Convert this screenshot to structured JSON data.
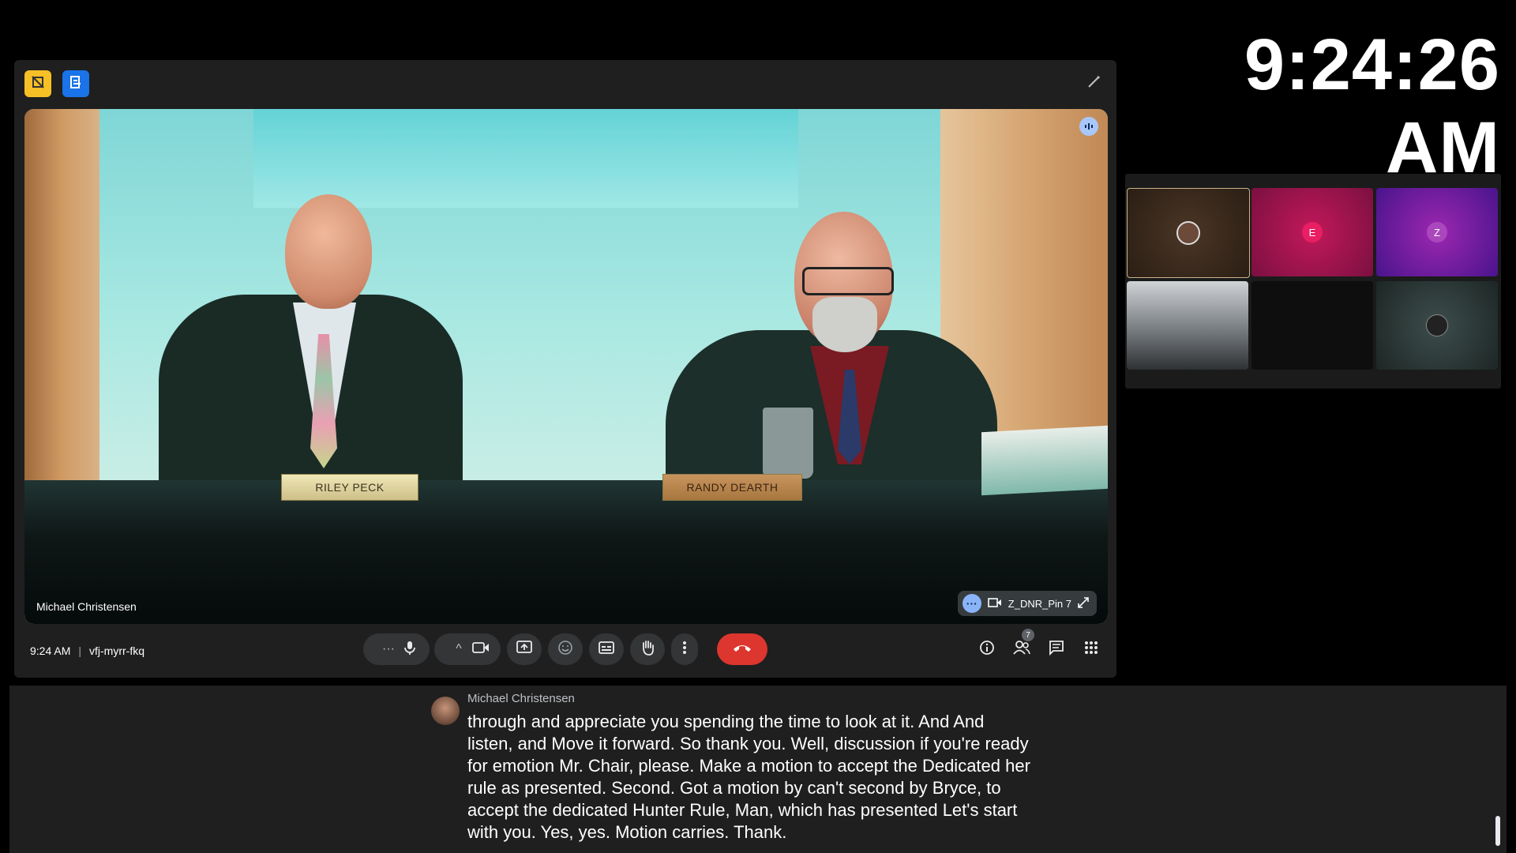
{
  "clock": "9:24:26 AM",
  "meeting": {
    "time": "9:24 AM",
    "code": "vfj-myrr-fkq",
    "speaker_name": "Michael Christensen",
    "nameplates": [
      "RILEY PECK",
      "RANDY DEARTH"
    ],
    "pinned_label": "Z_DNR_Pin 7",
    "participant_count": "7"
  },
  "grid": {
    "tiles": [
      {
        "initial": ""
      },
      {
        "initial": "E"
      },
      {
        "initial": "Z"
      }
    ]
  },
  "caption": {
    "speaker": "Michael Christensen",
    "lines": [
      "through and appreciate you spending the time to look at it. And And",
      "listen, and Move it forward. So thank you. Well, discussion if you're ready",
      "for emotion Mr. Chair, please. Make a motion to accept the Dedicated her",
      "rule as presented. Second. Got a motion by can't second by Bryce, to",
      "accept the dedicated Hunter Rule, Man, which has presented Let's start",
      "with you. Yes, yes. Motion carries. Thank."
    ]
  },
  "colors": {
    "end_call": "#dc362e",
    "accent_blue": "#1a73e8",
    "accent_yellow": "#f6c026"
  }
}
